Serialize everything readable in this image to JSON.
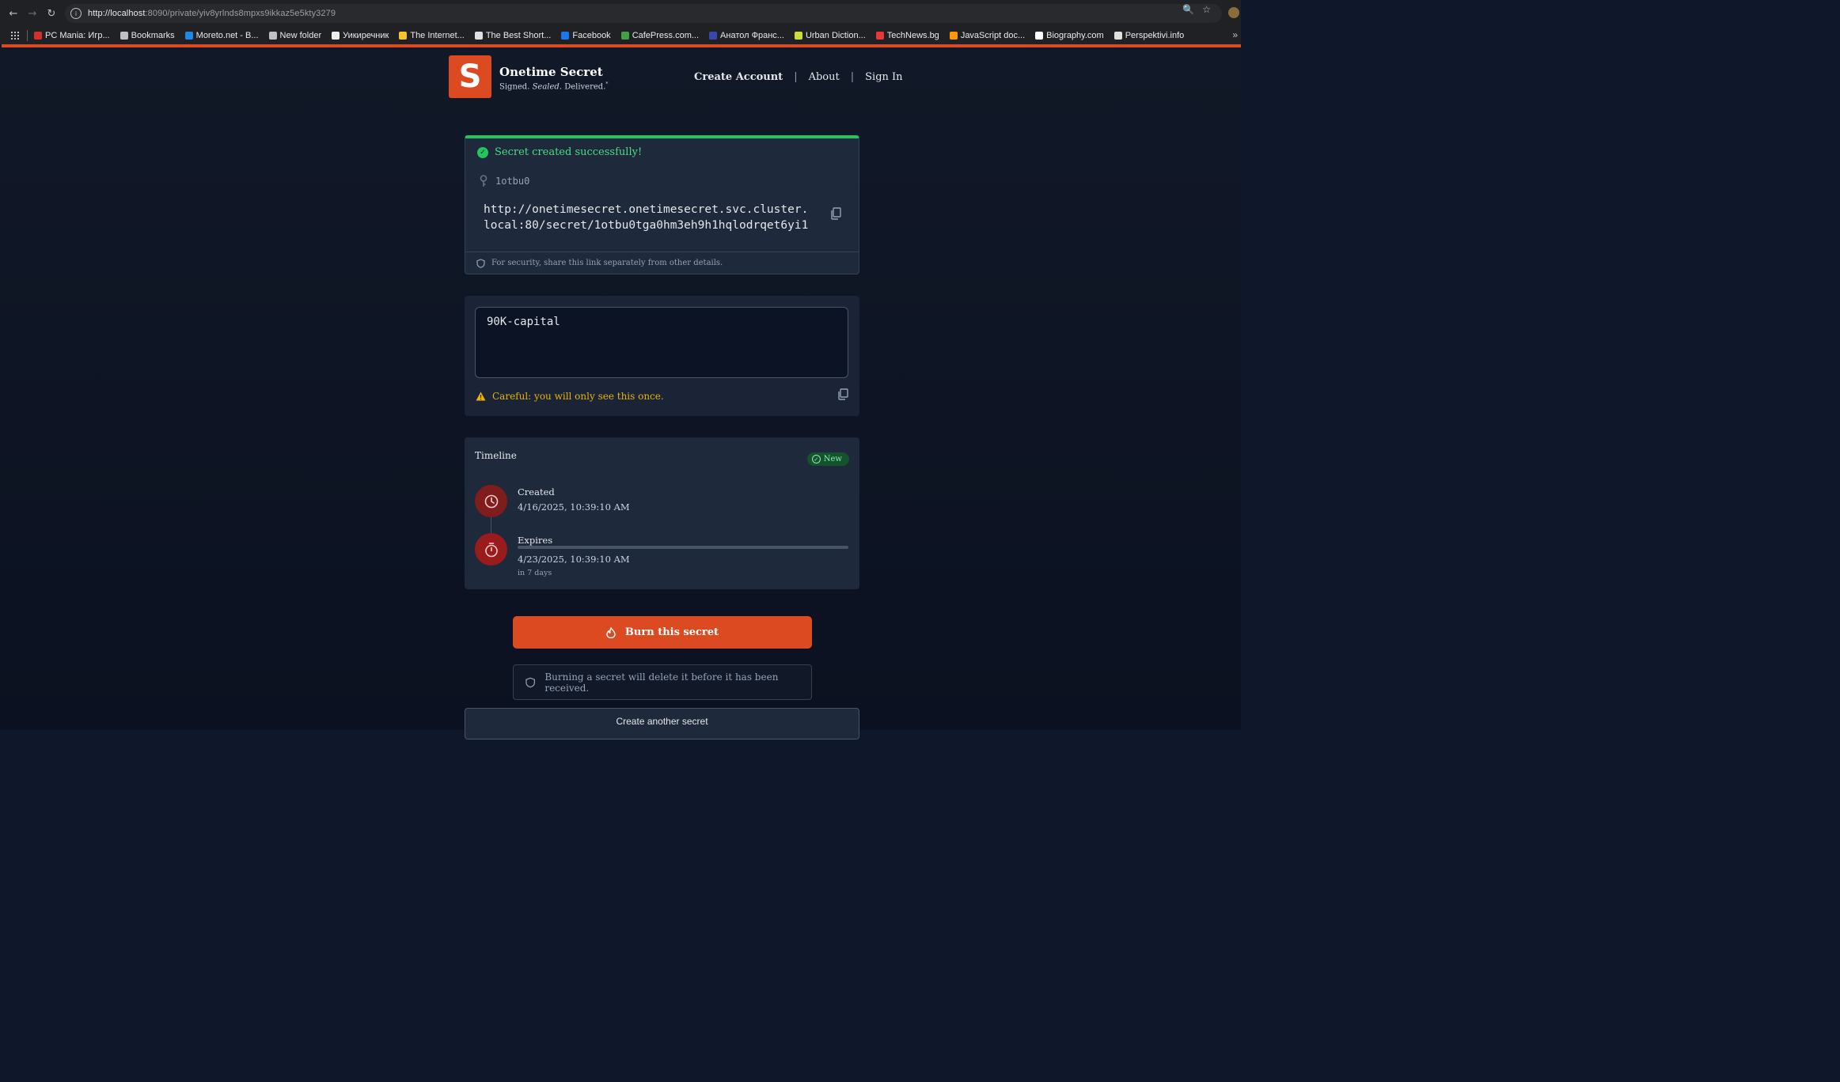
{
  "browser": {
    "url_host": "http://localhost",
    "url_path": ":8090/private/yiv8yrlnds8mpxs9ikkaz5e5kty3279",
    "bookmarks": [
      {
        "label": "PC Mania: Игр...",
        "color": "#d32f2f"
      },
      {
        "label": "Bookmarks",
        "color": "#bdc1c6"
      },
      {
        "label": "Moreto.net - B...",
        "color": "#1e88e5"
      },
      {
        "label": "New folder",
        "color": "#bdc1c6"
      },
      {
        "label": "Уикиречник",
        "color": "#eeeeee"
      },
      {
        "label": "The Internet...",
        "color": "#fbc02d"
      },
      {
        "label": "The Best Short...",
        "color": "#e0e0e0"
      },
      {
        "label": "Facebook",
        "color": "#1877f2"
      },
      {
        "label": "CafePress.com...",
        "color": "#43a047"
      },
      {
        "label": "Анатол Франс...",
        "color": "#3949ab"
      },
      {
        "label": "Urban Diction...",
        "color": "#cddc39"
      },
      {
        "label": "TechNews.bg",
        "color": "#e53935"
      },
      {
        "label": "JavaScript doc...",
        "color": "#ff9800"
      },
      {
        "label": "Biography.com",
        "color": "#ffffff"
      },
      {
        "label": "Perspektivi.info",
        "color": "#e0e0e0"
      }
    ]
  },
  "brand": {
    "logo_letter": "S",
    "name": "Onetime Secret",
    "tag_prefix": "Signed.",
    "tag_italic": "Sealed.",
    "tag_suffix": "Delivered.",
    "accent_color": "#dc4a22"
  },
  "nav": {
    "create_account": "Create Account",
    "about": "About",
    "sign_in": "Sign In",
    "separator": "|"
  },
  "success": {
    "message": "Secret created successfully!",
    "secret_key": "1otbu0",
    "share_url": "http://onetimesecret.onetimesecret.svc.cluster.local:80/secret/1otbu0tga0hm3eh9h1hqlodrqet6yi1",
    "security_note": "For security, share this link separately from other details."
  },
  "secret": {
    "value": "90K-capital",
    "warning": "Careful: you will only see this once."
  },
  "timeline": {
    "title": "Timeline",
    "badge": "New",
    "created_label": "Created",
    "created_date": "4/16/2025, 10:39:10 AM",
    "expires_label": "Expires",
    "expires_date": "4/23/2025, 10:39:10 AM",
    "expires_relative": "in 7 days",
    "elapsed_fraction": 0.0
  },
  "actions": {
    "burn_label": "Burn this secret",
    "burn_note": "Burning a secret will delete it before it has been received.",
    "create_another": "Create another secret"
  }
}
